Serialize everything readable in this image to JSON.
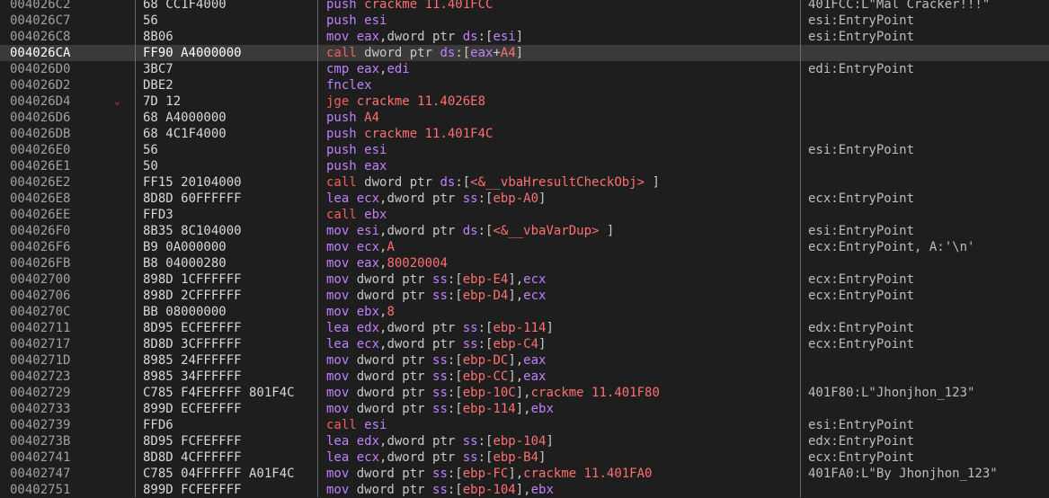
{
  "colors": {
    "background": "#1e1e1e",
    "selected_row": "#3a3a3a",
    "mnemonic": "#c080ff",
    "call_jump": "#ff5a5a",
    "number_symbol": "#ff7070",
    "text": "#c8c8c8",
    "column_divider": "#6b6b6b"
  },
  "selected_index": 3,
  "rows": [
    {
      "addr": "004026C2",
      "bytes": "68 CC1F4000",
      "arrow": "",
      "comment": "401FCC:L\"Mal Cracker!!!\"",
      "tokens": [
        [
          "push ",
          "mn"
        ],
        [
          "crackme 11.401FCC",
          "sym"
        ]
      ]
    },
    {
      "addr": "004026C7",
      "bytes": "56",
      "arrow": "",
      "comment": "esi:EntryPoint",
      "tokens": [
        [
          "push ",
          "mn"
        ],
        [
          "esi",
          "reg"
        ]
      ]
    },
    {
      "addr": "004026C8",
      "bytes": "8B06",
      "arrow": "",
      "comment": "esi:EntryPoint",
      "tokens": [
        [
          "mov ",
          "mn"
        ],
        [
          "eax",
          "reg"
        ],
        [
          ",dword ptr ",
          "plain"
        ],
        [
          "ds",
          "reg"
        ],
        [
          ":[",
          "plain"
        ],
        [
          "esi",
          "reg"
        ],
        [
          "]",
          "plain"
        ]
      ]
    },
    {
      "addr": "004026CA",
      "bytes": "FF90 A4000000",
      "arrow": "",
      "comment": "",
      "tokens": [
        [
          "call ",
          "call"
        ],
        [
          "dword ptr ",
          "plain"
        ],
        [
          "ds",
          "reg"
        ],
        [
          ":[",
          "plain"
        ],
        [
          "eax",
          "reg"
        ],
        [
          "+",
          "plain"
        ],
        [
          "A4",
          "num"
        ],
        [
          "]",
          "plain"
        ]
      ]
    },
    {
      "addr": "004026D0",
      "bytes": "3BC7",
      "arrow": "",
      "comment": "edi:EntryPoint",
      "tokens": [
        [
          "cmp ",
          "mn"
        ],
        [
          "eax",
          "reg"
        ],
        [
          ",",
          "plain"
        ],
        [
          "edi",
          "reg"
        ]
      ]
    },
    {
      "addr": "004026D2",
      "bytes": "DBE2",
      "arrow": "",
      "comment": "",
      "tokens": [
        [
          "fnclex",
          "mn"
        ]
      ]
    },
    {
      "addr": "004026D4",
      "bytes": "7D 12",
      "arrow": "⌄",
      "comment": "",
      "tokens": [
        [
          "jge ",
          "jcc"
        ],
        [
          "crackme 11.4026E8",
          "sym"
        ]
      ]
    },
    {
      "addr": "004026D6",
      "bytes": "68 A4000000",
      "arrow": "",
      "comment": "",
      "tokens": [
        [
          "push ",
          "mn"
        ],
        [
          "A4",
          "num"
        ]
      ]
    },
    {
      "addr": "004026DB",
      "bytes": "68 4C1F4000",
      "arrow": "",
      "comment": "",
      "tokens": [
        [
          "push ",
          "mn"
        ],
        [
          "crackme 11.401F4C",
          "sym"
        ]
      ]
    },
    {
      "addr": "004026E0",
      "bytes": "56",
      "arrow": "",
      "comment": "esi:EntryPoint",
      "tokens": [
        [
          "push ",
          "mn"
        ],
        [
          "esi",
          "reg"
        ]
      ]
    },
    {
      "addr": "004026E1",
      "bytes": "50",
      "arrow": "",
      "comment": "",
      "tokens": [
        [
          "push ",
          "mn"
        ],
        [
          "eax",
          "reg"
        ]
      ]
    },
    {
      "addr": "004026E2",
      "bytes": "FF15 20104000",
      "arrow": "",
      "comment": "",
      "tokens": [
        [
          "call ",
          "call"
        ],
        [
          "dword ptr ",
          "plain"
        ],
        [
          "ds",
          "reg"
        ],
        [
          ":[",
          "plain"
        ],
        [
          "<&__vbaHresultCheckObj>",
          "sym"
        ],
        [
          " ]",
          "plain"
        ]
      ]
    },
    {
      "addr": "004026E8",
      "bytes": "8D8D 60FFFFFF",
      "arrow": "",
      "comment": "ecx:EntryPoint",
      "tokens": [
        [
          "lea ",
          "mn"
        ],
        [
          "ecx",
          "reg"
        ],
        [
          ",dword ptr ",
          "plain"
        ],
        [
          "ss",
          "reg"
        ],
        [
          ":[",
          "plain"
        ],
        [
          "ebp-A0",
          "num"
        ],
        [
          "]",
          "plain"
        ]
      ]
    },
    {
      "addr": "004026EE",
      "bytes": "FFD3",
      "arrow": "",
      "comment": "",
      "tokens": [
        [
          "call ",
          "call"
        ],
        [
          "ebx",
          "reg"
        ]
      ]
    },
    {
      "addr": "004026F0",
      "bytes": "8B35 8C104000",
      "arrow": "",
      "comment": "esi:EntryPoint",
      "tokens": [
        [
          "mov ",
          "mn"
        ],
        [
          "esi",
          "reg"
        ],
        [
          ",dword ptr ",
          "plain"
        ],
        [
          "ds",
          "reg"
        ],
        [
          ":[",
          "plain"
        ],
        [
          "<&__vbaVarDup>",
          "sym"
        ],
        [
          " ]",
          "plain"
        ]
      ]
    },
    {
      "addr": "004026F6",
      "bytes": "B9 0A000000",
      "arrow": "",
      "comment": "ecx:EntryPoint, A:'\\n'",
      "tokens": [
        [
          "mov ",
          "mn"
        ],
        [
          "ecx",
          "reg"
        ],
        [
          ",",
          "plain"
        ],
        [
          "A",
          "num"
        ]
      ]
    },
    {
      "addr": "004026FB",
      "bytes": "B8 04000280",
      "arrow": "",
      "comment": "",
      "tokens": [
        [
          "mov ",
          "mn"
        ],
        [
          "eax",
          "reg"
        ],
        [
          ",",
          "plain"
        ],
        [
          "80020004",
          "num"
        ]
      ]
    },
    {
      "addr": "00402700",
      "bytes": "898D 1CFFFFFF",
      "arrow": "",
      "comment": "ecx:EntryPoint",
      "tokens": [
        [
          "mov ",
          "mn"
        ],
        [
          "dword ptr ",
          "plain"
        ],
        [
          "ss",
          "reg"
        ],
        [
          ":[",
          "plain"
        ],
        [
          "ebp-E4",
          "num"
        ],
        [
          "],",
          "plain"
        ],
        [
          "ecx",
          "reg"
        ]
      ]
    },
    {
      "addr": "00402706",
      "bytes": "898D 2CFFFFFF",
      "arrow": "",
      "comment": "ecx:EntryPoint",
      "tokens": [
        [
          "mov ",
          "mn"
        ],
        [
          "dword ptr ",
          "plain"
        ],
        [
          "ss",
          "reg"
        ],
        [
          ":[",
          "plain"
        ],
        [
          "ebp-D4",
          "num"
        ],
        [
          "],",
          "plain"
        ],
        [
          "ecx",
          "reg"
        ]
      ]
    },
    {
      "addr": "0040270C",
      "bytes": "BB 08000000",
      "arrow": "",
      "comment": "",
      "tokens": [
        [
          "mov ",
          "mn"
        ],
        [
          "ebx",
          "reg"
        ],
        [
          ",",
          "plain"
        ],
        [
          "8",
          "num"
        ]
      ]
    },
    {
      "addr": "00402711",
      "bytes": "8D95 ECFEFFFF",
      "arrow": "",
      "comment": "edx:EntryPoint",
      "tokens": [
        [
          "lea ",
          "mn"
        ],
        [
          "edx",
          "reg"
        ],
        [
          ",dword ptr ",
          "plain"
        ],
        [
          "ss",
          "reg"
        ],
        [
          ":[",
          "plain"
        ],
        [
          "ebp-114",
          "num"
        ],
        [
          "]",
          "plain"
        ]
      ]
    },
    {
      "addr": "00402717",
      "bytes": "8D8D 3CFFFFFF",
      "arrow": "",
      "comment": "ecx:EntryPoint",
      "tokens": [
        [
          "lea ",
          "mn"
        ],
        [
          "ecx",
          "reg"
        ],
        [
          ",dword ptr ",
          "plain"
        ],
        [
          "ss",
          "reg"
        ],
        [
          ":[",
          "plain"
        ],
        [
          "ebp-C4",
          "num"
        ],
        [
          "]",
          "plain"
        ]
      ]
    },
    {
      "addr": "0040271D",
      "bytes": "8985 24FFFFFF",
      "arrow": "",
      "comment": "",
      "tokens": [
        [
          "mov ",
          "mn"
        ],
        [
          "dword ptr ",
          "plain"
        ],
        [
          "ss",
          "reg"
        ],
        [
          ":[",
          "plain"
        ],
        [
          "ebp-DC",
          "num"
        ],
        [
          "],",
          "plain"
        ],
        [
          "eax",
          "reg"
        ]
      ]
    },
    {
      "addr": "00402723",
      "bytes": "8985 34FFFFFF",
      "arrow": "",
      "comment": "",
      "tokens": [
        [
          "mov ",
          "mn"
        ],
        [
          "dword ptr ",
          "plain"
        ],
        [
          "ss",
          "reg"
        ],
        [
          ":[",
          "plain"
        ],
        [
          "ebp-CC",
          "num"
        ],
        [
          "],",
          "plain"
        ],
        [
          "eax",
          "reg"
        ]
      ]
    },
    {
      "addr": "00402729",
      "bytes": "C785 F4FEFFFF 801F4C",
      "arrow": "",
      "comment": "401F80:L\"Jhonjhon_123\"",
      "tokens": [
        [
          "mov ",
          "mn"
        ],
        [
          "dword ptr ",
          "plain"
        ],
        [
          "ss",
          "reg"
        ],
        [
          ":[",
          "plain"
        ],
        [
          "ebp-10C",
          "num"
        ],
        [
          "],",
          "plain"
        ],
        [
          "crackme 11.401F80",
          "sym"
        ]
      ]
    },
    {
      "addr": "00402733",
      "bytes": "899D ECFEFFFF",
      "arrow": "",
      "comment": "",
      "tokens": [
        [
          "mov ",
          "mn"
        ],
        [
          "dword ptr ",
          "plain"
        ],
        [
          "ss",
          "reg"
        ],
        [
          ":[",
          "plain"
        ],
        [
          "ebp-114",
          "num"
        ],
        [
          "],",
          "plain"
        ],
        [
          "ebx",
          "reg"
        ]
      ]
    },
    {
      "addr": "00402739",
      "bytes": "FFD6",
      "arrow": "",
      "comment": "esi:EntryPoint",
      "tokens": [
        [
          "call ",
          "call"
        ],
        [
          "esi",
          "reg"
        ]
      ]
    },
    {
      "addr": "0040273B",
      "bytes": "8D95 FCFEFFFF",
      "arrow": "",
      "comment": "edx:EntryPoint",
      "tokens": [
        [
          "lea ",
          "mn"
        ],
        [
          "edx",
          "reg"
        ],
        [
          ",dword ptr ",
          "plain"
        ],
        [
          "ss",
          "reg"
        ],
        [
          ":[",
          "plain"
        ],
        [
          "ebp-104",
          "num"
        ],
        [
          "]",
          "plain"
        ]
      ]
    },
    {
      "addr": "00402741",
      "bytes": "8D8D 4CFFFFFF",
      "arrow": "",
      "comment": "ecx:EntryPoint",
      "tokens": [
        [
          "lea ",
          "mn"
        ],
        [
          "ecx",
          "reg"
        ],
        [
          ",dword ptr ",
          "plain"
        ],
        [
          "ss",
          "reg"
        ],
        [
          ":[",
          "plain"
        ],
        [
          "ebp-B4",
          "num"
        ],
        [
          "]",
          "plain"
        ]
      ]
    },
    {
      "addr": "00402747",
      "bytes": "C785 04FFFFFF A01F4C",
      "arrow": "",
      "comment": "401FA0:L\"By Jhonjhon_123\"",
      "tokens": [
        [
          "mov ",
          "mn"
        ],
        [
          "dword ptr ",
          "plain"
        ],
        [
          "ss",
          "reg"
        ],
        [
          ":[",
          "plain"
        ],
        [
          "ebp-FC",
          "num"
        ],
        [
          "],",
          "plain"
        ],
        [
          "crackme 11.401FA0",
          "sym"
        ]
      ]
    },
    {
      "addr": "00402751",
      "bytes": "899D FCFEFFFF",
      "arrow": "",
      "comment": "",
      "tokens": [
        [
          "mov ",
          "mn"
        ],
        [
          "dword ptr ",
          "plain"
        ],
        [
          "ss",
          "reg"
        ],
        [
          ":[",
          "plain"
        ],
        [
          "ebp-104",
          "num"
        ],
        [
          "],",
          "plain"
        ],
        [
          "ebx",
          "reg"
        ]
      ]
    }
  ]
}
